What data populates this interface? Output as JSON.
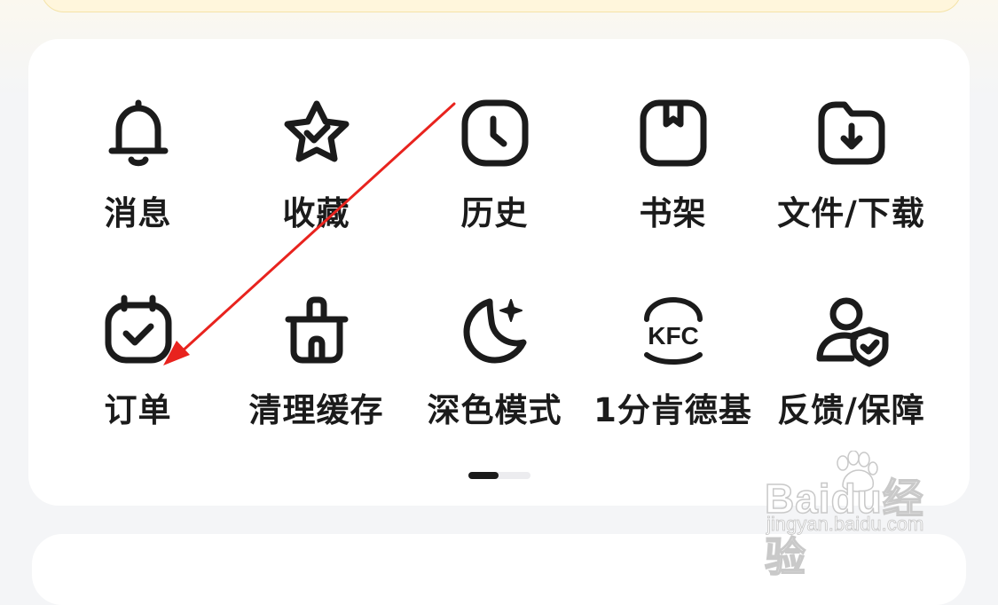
{
  "menu": {
    "items": [
      {
        "label": "消息",
        "icon": "bell-icon"
      },
      {
        "label": "收藏",
        "icon": "star-icon"
      },
      {
        "label": "历史",
        "icon": "clock-icon"
      },
      {
        "label": "书架",
        "icon": "bookmark-icon"
      },
      {
        "label": "文件/下载",
        "icon": "folder-download-icon"
      },
      {
        "label": "订单",
        "icon": "calendar-check-icon"
      },
      {
        "label": "清理缓存",
        "icon": "trash-icon"
      },
      {
        "label": "深色模式",
        "icon": "moon-icon"
      },
      {
        "label": "1分肯德基",
        "icon": "kfc-icon"
      },
      {
        "label": "反馈/保障",
        "icon": "user-shield-icon"
      }
    ]
  },
  "pager": {
    "current_page": 1,
    "total_pages": 2
  },
  "icons": {
    "kfc_text": "KFC"
  },
  "watermark": {
    "brand": "Baidu经验",
    "url": "jingyan.baidu.com"
  },
  "colors": {
    "icon_stroke": "#1b1b1b",
    "annotation_arrow": "#e8231e",
    "card_background": "#ffffff",
    "page_background": "#f4f5f7"
  }
}
